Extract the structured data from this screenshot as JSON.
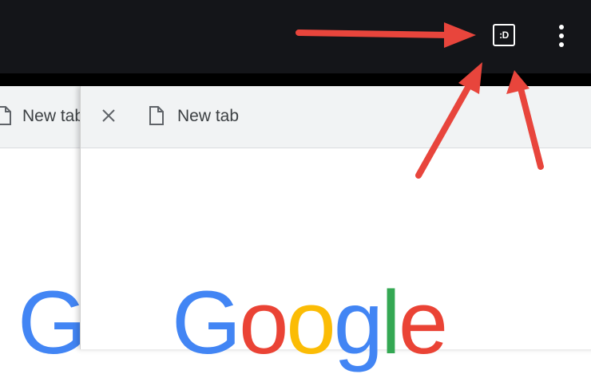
{
  "toolbar": {
    "tab_counter_label": ":D",
    "more_menu_icon": "vertical-dots-icon"
  },
  "back_card": {
    "tab_title": "New tab",
    "logo_partial": "G"
  },
  "front_card": {
    "tab_title": "New tab",
    "close_icon": "close-icon",
    "page_icon": "document-icon",
    "logo_letters": [
      "G",
      "o",
      "o",
      "g",
      "l",
      "e"
    ]
  },
  "colors": {
    "toolbar_bg": "#141519",
    "arrow": "#e8453c",
    "google_blue": "#4285f4",
    "google_red": "#ea4335",
    "google_yellow": "#fbbc05",
    "google_green": "#34a853"
  }
}
